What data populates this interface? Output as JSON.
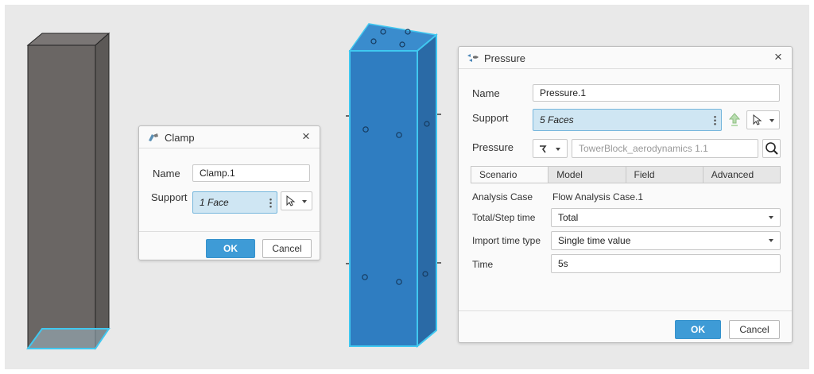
{
  "clamp_dialog": {
    "title": "Clamp",
    "close": "×",
    "name_label": "Name",
    "name_value": "Clamp.1",
    "support_label": "Support",
    "support_value": "1 Face",
    "ok_label": "OK",
    "cancel_label": "Cancel"
  },
  "pressure_dialog": {
    "title": "Pressure",
    "close": "×",
    "name_label": "Name",
    "name_value": "Pressure.1",
    "support_label": "Support",
    "support_value": "5 Faces",
    "pressure_label": "Pressure",
    "pressure_source": "TowerBlock_aerodynamics 1.1",
    "tabs": [
      {
        "label": "Scenario"
      },
      {
        "label": "Model"
      },
      {
        "label": "Field"
      },
      {
        "label": "Advanced"
      }
    ],
    "analysis_case_label": "Analysis Case",
    "analysis_case_value": "Flow Analysis Case.1",
    "step_time_label": "Total/Step time",
    "step_time_value": "Total",
    "import_time_label": "Import time type",
    "import_time_value": "Single time value",
    "time_label": "Time",
    "time_value": "5s",
    "ok_label": "OK",
    "cancel_label": "Cancel"
  },
  "colors": {
    "viewport_bg": "#e9e9e9",
    "clamp_block": "#6a6664",
    "pressure_block": "#2f7dc1",
    "highlight": "#40c8f0",
    "ok_button": "#3e9bd6",
    "selected_field": "#cfe6f3"
  }
}
